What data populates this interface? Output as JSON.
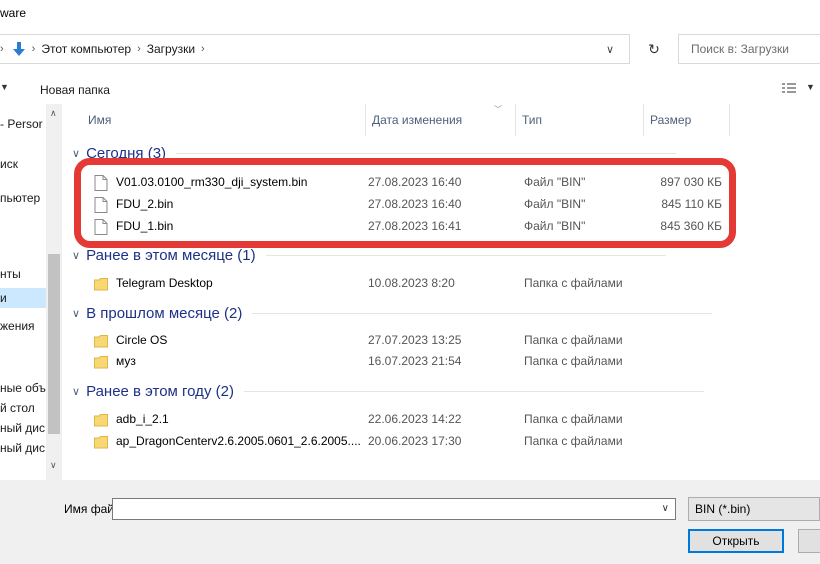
{
  "window": {
    "title": "ware"
  },
  "address": {
    "crumbs": [
      "Этот компьютер",
      "Загрузки"
    ],
    "search_placeholder": "Поиск в: Загрузки"
  },
  "toolbar": {
    "new_folder_label": "Новая папка"
  },
  "nav": {
    "items": [
      {
        "label": "- Persor",
        "selected": false
      },
      {
        "label": "иск",
        "selected": false
      },
      {
        "label": "пьютер",
        "selected": false
      },
      {
        "label": "нты",
        "selected": false
      },
      {
        "label": "и",
        "selected": true
      },
      {
        "label": "жения",
        "selected": false
      },
      {
        "label": "ные объ",
        "selected": false
      },
      {
        "label": "й стол",
        "selected": false
      },
      {
        "label": "ный дис",
        "selected": false
      },
      {
        "label": "ный дис",
        "selected": false
      }
    ]
  },
  "columns": {
    "name": "Имя",
    "date": "Дата изменения",
    "type": "Тип",
    "size": "Размер"
  },
  "groups": [
    {
      "label": "Сегодня (3)",
      "items": [
        {
          "name": "V01.03.0100_rm330_dji_system.bin",
          "date": "27.08.2023 16:40",
          "type": "Файл \"BIN\"",
          "size": "897 030 КБ",
          "kind": "file"
        },
        {
          "name": "FDU_2.bin",
          "date": "27.08.2023 16:40",
          "type": "Файл \"BIN\"",
          "size": "845 110 КБ",
          "kind": "file"
        },
        {
          "name": "FDU_1.bin",
          "date": "27.08.2023 16:41",
          "type": "Файл \"BIN\"",
          "size": "845 360 КБ",
          "kind": "file"
        }
      ]
    },
    {
      "label": "Ранее в этом месяце (1)",
      "items": [
        {
          "name": "Telegram Desktop",
          "date": "10.08.2023 8:20",
          "type": "Папка с файлами",
          "size": "",
          "kind": "folder"
        }
      ]
    },
    {
      "label": "В прошлом месяце (2)",
      "items": [
        {
          "name": "Circle OS",
          "date": "27.07.2023 13:25",
          "type": "Папка с файлами",
          "size": "",
          "kind": "folder"
        },
        {
          "name": "муз",
          "date": "16.07.2023 21:54",
          "type": "Папка с файлами",
          "size": "",
          "kind": "folder"
        }
      ]
    },
    {
      "label": "Ранее в этом году (2)",
      "items": [
        {
          "name": "adb_i_2.1",
          "date": "22.06.2023 14:22",
          "type": "Папка с файлами",
          "size": "",
          "kind": "folder"
        },
        {
          "name": "ap_DragonCenterv2.6.2005.0601_2.6.2005....",
          "date": "20.06.2023 17:30",
          "type": "Папка с файлами",
          "size": "",
          "kind": "folder"
        }
      ]
    }
  ],
  "bottom": {
    "filename_label": "Имя файла:",
    "filename_value": "",
    "filter_value": "BIN (*.bin)",
    "open_label": "Открыть"
  },
  "colors": {
    "group_header": "#1e3287",
    "highlight": "#e53935",
    "folder": "#f8d775",
    "selected": "#cce8ff",
    "accent": "#0078d7"
  }
}
